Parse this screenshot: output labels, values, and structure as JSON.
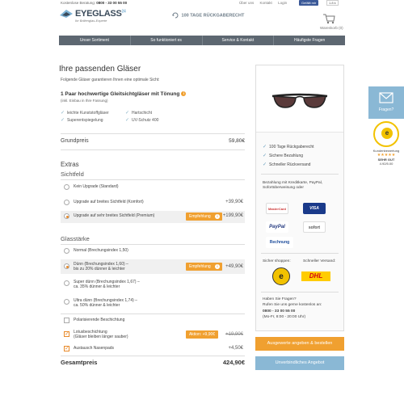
{
  "topbar": {
    "phone_label": "Kostenlose Beratung:",
    "phone_number": "0800 - 33 00 55 00",
    "links": [
      "Über uns",
      "Kontakt",
      "Login"
    ],
    "facebook_label": "Gefällt mir",
    "likes": "1.8 k"
  },
  "header": {
    "logo_name": "EYEGLASS",
    "logo_suffix": "24",
    "logo_tagline": "Ihr Brillenglas-Experte",
    "guarantee": "100 TAGE RÜCKGABERECHT",
    "cart_label": "Warenkorb (0)"
  },
  "nav": [
    "Unser Sortiment",
    "So funktioniert es",
    "Service & Kontakt",
    "Häufigste Fragen"
  ],
  "main": {
    "title": "Ihre passenden Gläser",
    "subtitle": "Folgende Gläser garantieren Ihnen eine optimale Sicht:",
    "product_title": "1 Paar hochwertige Gleitsichtgläser mit Tönung",
    "product_note": "(inkl. Einbau in Ihre Fassung)",
    "features": [
      "leichte Kunststoffgläser",
      "Hartschicht",
      "Superentspiegelung",
      "UV-Schutz 400"
    ],
    "base_label": "Grundpreis",
    "base_price": "59,80€",
    "extras_label": "Extras",
    "sichtfeld_label": "Sichtfeld",
    "sichtfeld_options": [
      {
        "label": "Kein Upgrade (Standard)",
        "price": ""
      },
      {
        "label": "Upgrade auf breites Sichtfeld (Komfort)",
        "price": "+39,90€"
      },
      {
        "label": "Upgrade auf sehr breites Sichtfeld (Premium)",
        "price": "+199,90€",
        "badge": "Empfehlung"
      }
    ],
    "glasstaerke_label": "Glasstärke",
    "glasstaerke_options": [
      {
        "label": "Normal (Brechungsindex 1,50)",
        "price": ""
      },
      {
        "label": "Dünn (Brechungsindex 1,60) –",
        "label2": "bis zu 20% dünner & leichter",
        "price": "+49,90€",
        "badge": "Empfehlung"
      },
      {
        "label": "Super dünn (Brechungsindex 1,67) –",
        "label2": "ca. 35% dünner & leichter",
        "price": ""
      },
      {
        "label": "Ultra dünn (Brechungsindex 1,74) –",
        "label2": "ca. 50% dünner & leichter",
        "price": ""
      }
    ],
    "checkbox_options": [
      {
        "label": "Polarisierende Beschichtung",
        "price": ""
      },
      {
        "label": "Lotusbeschichtung",
        "label2": "(Gläser bleiben länger sauber)",
        "old_price": "+19,90€",
        "badge": "Aktion: +9,90€"
      },
      {
        "label": "Austausch Nasenpads",
        "price": "+4,50€"
      }
    ],
    "total_label": "Gesamtpreis",
    "total_price": "424,90€"
  },
  "sidebar": {
    "features": [
      "100 Tage Rückgaberecht",
      "Sichere Bezahlung",
      "Schneller Rückversand"
    ],
    "payment_text": "Bezahlung mit Kreditkarte, PayPal, Sofortüberweisung oder",
    "payment_logos": [
      "MasterCard",
      "VISA",
      "PayPal",
      "sofort",
      "Rechnung"
    ],
    "secure_label": "Sicher shoppen:",
    "shipping_label": "Schneller Versand:",
    "dhl": "DHL",
    "questions_title": "Haben Sie Fragen?",
    "questions_text": "Rufen Sie uns gerne kostenlos an:",
    "phone": "0800 - 33 00 55 00",
    "hours": "(Mo-Fr, 8:00 - 20:00 Uhr)"
  },
  "cta": {
    "primary": "Ausgewerte angeben & bestellen",
    "secondary": "Unverbindliches Angebot"
  },
  "widget": {
    "label": "Fragen?",
    "rating_label": "Kundenbewertung",
    "rating_text": "SEHR GUT",
    "rating_value": "4.92/5.00"
  },
  "colors": {
    "accent": "#f0a030",
    "nav": "#5d6771",
    "blue": "#8ab8d5"
  }
}
